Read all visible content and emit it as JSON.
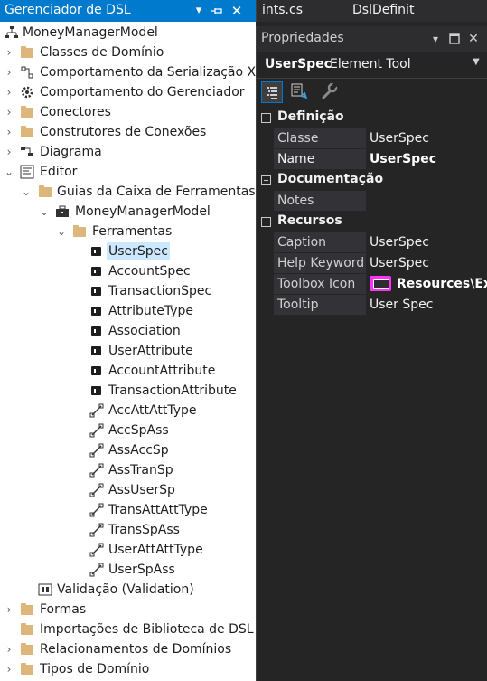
{
  "explorer": {
    "title": "Gerenciador de DSL",
    "title_buttons": [
      "dropdown-icon",
      "pin-icon",
      "close-icon"
    ],
    "tree": [
      {
        "label": "MoneyManagerModel",
        "icon": "model-tree-icon",
        "expander": "none"
      },
      {
        "label": "Classes de Domínio",
        "icon": "folder-icon",
        "expander": "collapsed"
      },
      {
        "label": "Comportamento da Serialização XML",
        "icon": "serialization-icon",
        "expander": "collapsed"
      },
      {
        "label": "Comportamento do Gerenciador",
        "icon": "gear-icon",
        "expander": "collapsed"
      },
      {
        "label": "Conectores",
        "icon": "folder-icon",
        "expander": "collapsed"
      },
      {
        "label": "Construtores de Conexões",
        "icon": "folder-icon",
        "expander": "collapsed"
      },
      {
        "label": "Diagrama",
        "icon": "diagram-icon",
        "expander": "collapsed"
      },
      {
        "label": "Editor",
        "icon": "editor-icon",
        "expander": "expanded"
      },
      {
        "label": "Guias da Caixa de Ferramentas",
        "icon": "folder-icon",
        "expander": "expanded"
      },
      {
        "label": "MoneyManagerModel",
        "icon": "toolbox-icon",
        "expander": "expanded"
      },
      {
        "label": "Ferramentas",
        "icon": "folder-icon",
        "expander": "expanded"
      },
      {
        "label": "UserSpec",
        "icon": "element-tool-icon",
        "expander": "none",
        "selected": true
      },
      {
        "label": "AccountSpec",
        "icon": "element-tool-icon",
        "expander": "none"
      },
      {
        "label": "TransactionSpec",
        "icon": "element-tool-icon",
        "expander": "none"
      },
      {
        "label": "AttributeType",
        "icon": "element-tool-icon",
        "expander": "none"
      },
      {
        "label": "Association",
        "icon": "element-tool-icon",
        "expander": "none"
      },
      {
        "label": "UserAttribute",
        "icon": "element-tool-icon",
        "expander": "none"
      },
      {
        "label": "AccountAttribute",
        "icon": "element-tool-icon",
        "expander": "none"
      },
      {
        "label": "TransactionAttribute",
        "icon": "element-tool-icon",
        "expander": "none"
      },
      {
        "label": "AccAttAttType",
        "icon": "connection-tool-icon",
        "expander": "none"
      },
      {
        "label": "AccSpAss",
        "icon": "connection-tool-icon",
        "expander": "none"
      },
      {
        "label": "AssAccSp",
        "icon": "connection-tool-icon",
        "expander": "none"
      },
      {
        "label": "AssTranSp",
        "icon": "connection-tool-icon",
        "expander": "none"
      },
      {
        "label": "AssUserSp",
        "icon": "connection-tool-icon",
        "expander": "none"
      },
      {
        "label": "TransAttAttType",
        "icon": "connection-tool-icon",
        "expander": "none"
      },
      {
        "label": "TransSpAss",
        "icon": "connection-tool-icon",
        "expander": "none"
      },
      {
        "label": "UserAttAttType",
        "icon": "connection-tool-icon",
        "expander": "none"
      },
      {
        "label": "UserSpAss",
        "icon": "connection-tool-icon",
        "expander": "none"
      },
      {
        "label": "Validação (Validation)",
        "icon": "validation-icon",
        "expander": "none"
      },
      {
        "label": "Formas",
        "icon": "folder-icon",
        "expander": "collapsed"
      },
      {
        "label": "Importações de Biblioteca de DSL",
        "icon": "folder-icon",
        "expander": "none"
      },
      {
        "label": "Relacionamentos de Domínios",
        "icon": "folder-icon",
        "expander": "collapsed"
      },
      {
        "label": "Tipos de Domínio",
        "icon": "folder-icon",
        "expander": "collapsed"
      }
    ]
  },
  "doc_tabs": [
    "ints.cs",
    "DslDefinit"
  ],
  "properties": {
    "title": "Propriedades",
    "title_buttons": [
      "dropdown-icon",
      "maximize-icon",
      "close-icon"
    ],
    "object_name": "UserSpec",
    "object_type": "Element Tool",
    "toolbar": [
      "categorized-icon",
      "property-pages-icon",
      "wrench-icon"
    ],
    "categories": [
      {
        "name": "Definição",
        "rows": [
          {
            "name": "Classe",
            "value": "UserSpec"
          },
          {
            "name": "Name",
            "value": "UserSpec",
            "bold": true
          }
        ]
      },
      {
        "name": "Documentação",
        "rows": [
          {
            "name": "Notes",
            "value": ""
          }
        ]
      },
      {
        "name": "Recursos",
        "rows": [
          {
            "name": "Caption",
            "value": "UserSpec"
          },
          {
            "name": "Help Keyword",
            "value": "UserSpec"
          },
          {
            "name": "Toolbox Icon",
            "value": "Resources\\Exa",
            "bold": true,
            "swatch": true
          },
          {
            "name": "Tooltip",
            "value": "User Spec"
          }
        ]
      }
    ]
  },
  "colors": {
    "title_bar": "#007acc",
    "selection": "#cce8ff",
    "folder": "#dcb67a",
    "dark_panel": "#252526",
    "swatch": "#ff32ff"
  }
}
